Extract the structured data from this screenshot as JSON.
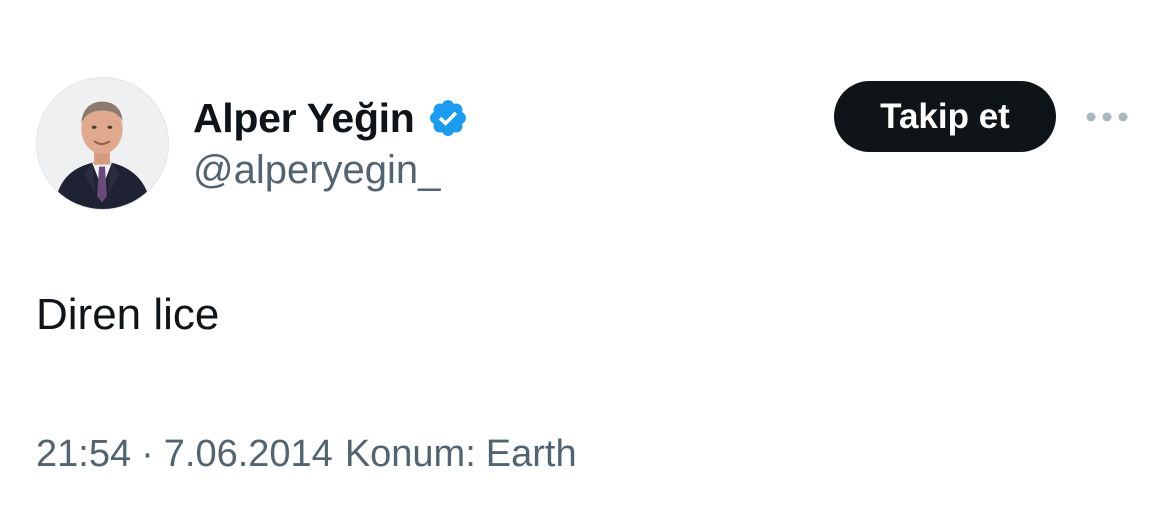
{
  "author": {
    "display_name": "Alper Yeğin",
    "handle": "@alperyegin_",
    "verified": true,
    "verified_color": "#1d9bf0",
    "avatar_icon": "profile-photo"
  },
  "actions": {
    "follow_label": "Takip et",
    "more_icon": "more-horizontal-icon"
  },
  "tweet": {
    "text": "Diren lice",
    "time": "21:54",
    "separator": "·",
    "date": "7.06.2014",
    "location_label": "Konum:",
    "location_value": "Earth"
  },
  "colors": {
    "text_primary": "#0f1419",
    "text_secondary": "#536471",
    "button_bg": "#0f1419",
    "button_text": "#ffffff"
  }
}
